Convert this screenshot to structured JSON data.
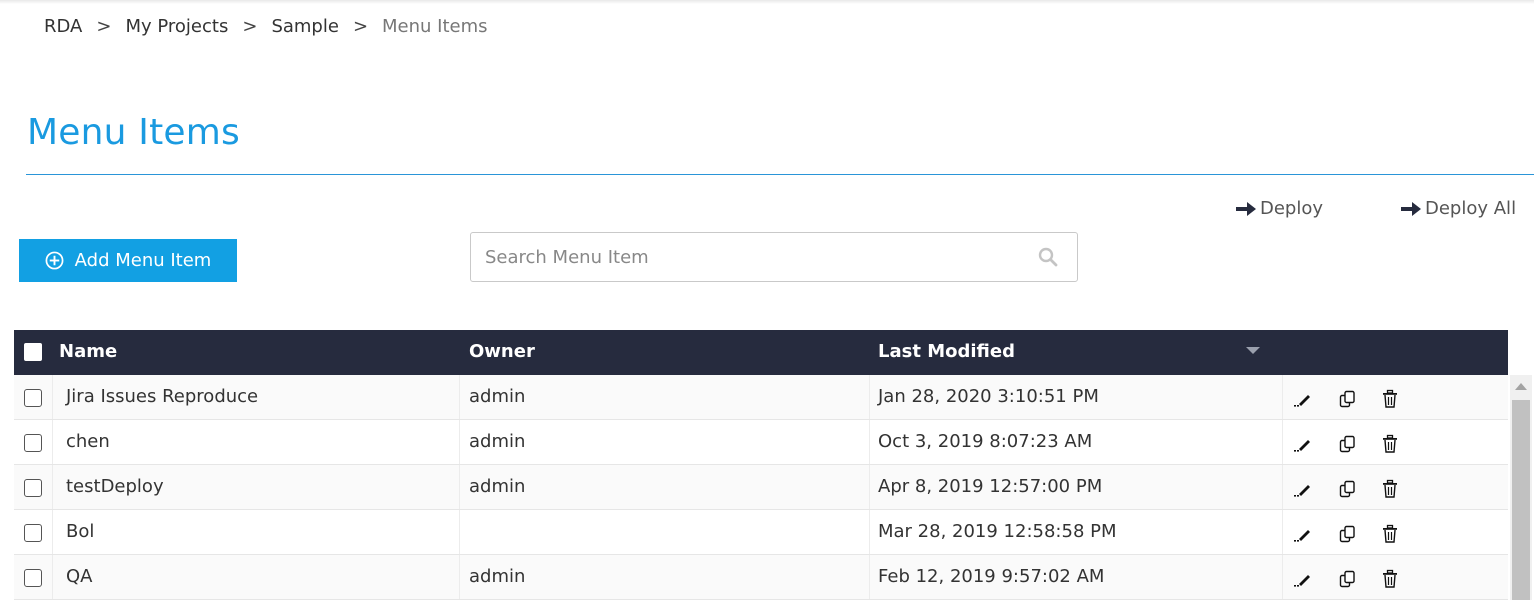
{
  "breadcrumb": {
    "items": [
      "RDA",
      "My Projects",
      "Sample"
    ],
    "separator": ">",
    "current": "Menu Items"
  },
  "page": {
    "title": "Menu Items"
  },
  "actions": {
    "deploy_label": "Deploy",
    "deploy_all_label": "Deploy All",
    "add_label": "Add Menu Item"
  },
  "search": {
    "placeholder": "Search Menu Item",
    "value": ""
  },
  "table": {
    "columns": {
      "name": "Name",
      "owner": "Owner",
      "last_modified": "Last Modified"
    },
    "sort": {
      "column": "Last Modified",
      "direction": "descending"
    },
    "rows": [
      {
        "name": "Jira Issues Reproduce",
        "owner": "admin",
        "modified": "Jan 28, 2020 3:10:51 PM"
      },
      {
        "name": "chen",
        "owner": "admin",
        "modified": "Oct 3, 2019 8:07:23 AM"
      },
      {
        "name": "testDeploy",
        "owner": "admin",
        "modified": "Apr 8, 2019 12:57:00 PM"
      },
      {
        "name": "Bol",
        "owner": "",
        "modified": "Mar 28, 2019 12:58:58 PM"
      },
      {
        "name": "QA",
        "owner": "admin",
        "modified": "Feb 12, 2019 9:57:02 AM"
      }
    ],
    "row_actions": [
      "edit-icon",
      "copy-icon",
      "delete-icon"
    ]
  },
  "colors": {
    "accent": "#1a9ae0",
    "button": "#12a0e3",
    "table_header": "#262b3e"
  }
}
